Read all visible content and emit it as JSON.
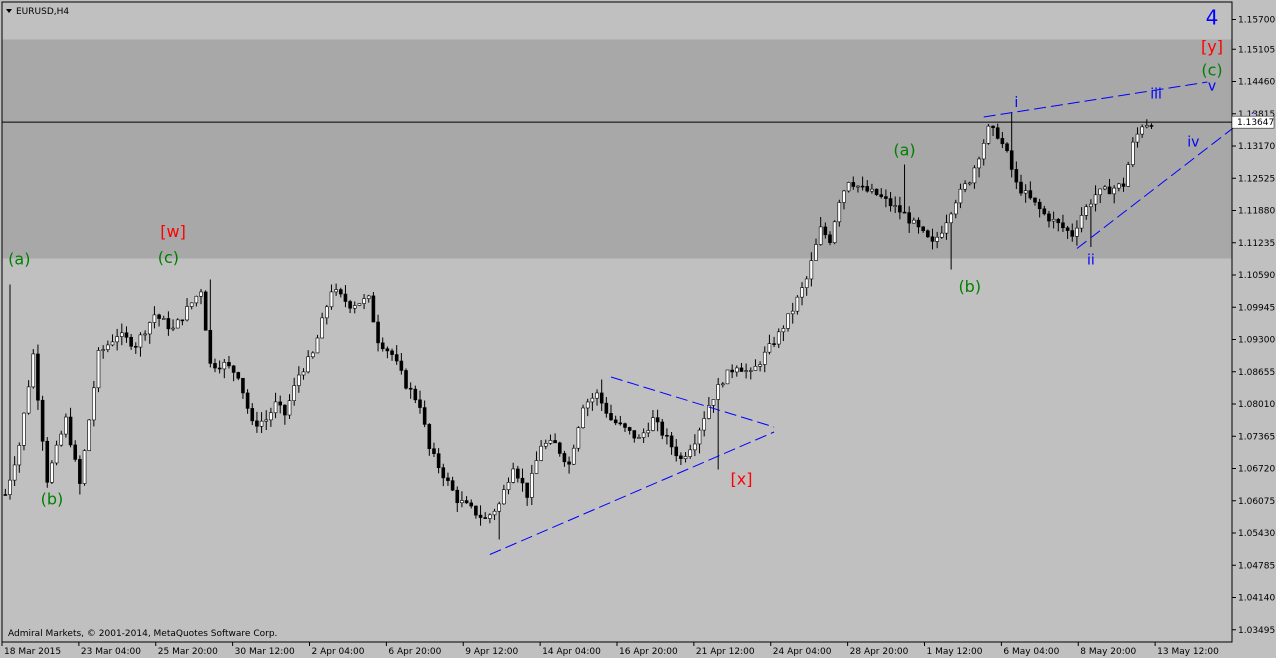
{
  "symbol_label": "EURUSD,H4",
  "copyright": "Admiral Markets, © 2001-2014, MetaQuotes Software Corp.",
  "current_price": "1.13647",
  "colors": {
    "background": "#c0c0c0",
    "zone": "#a8a8a8",
    "candle": "#000000",
    "wave_green": "#008000",
    "wave_red": "#ff0000",
    "wave_blue": "#0000ff"
  },
  "chart_data": {
    "type": "candlestick",
    "timeframe": "H4",
    "ylim": [
      1.0325,
      1.1605
    ],
    "y_ticks": [
      "1.15700",
      "1.15105",
      "1.14460",
      "1.13815",
      "1.13170",
      "1.12525",
      "1.11880",
      "1.11235",
      "1.10590",
      "1.09945",
      "1.09300",
      "1.08655",
      "1.08010",
      "1.07365",
      "1.06720",
      "1.06075",
      "1.05430",
      "1.04785",
      "1.04140",
      "1.03495"
    ],
    "x_ticks": [
      "18 Mar 2015",
      "23 Mar 04:00",
      "25 Mar 20:00",
      "30 Mar 12:00",
      "2 Apr 04:00",
      "6 Apr 20:00",
      "9 Apr 12:00",
      "14 Apr 04:00",
      "16 Apr 20:00",
      "21 Apr 12:00",
      "24 Apr 04:00",
      "28 Apr 20:00",
      "1 May 12:00",
      "6 May 04:00",
      "8 May 20:00",
      "13 May 12:00"
    ],
    "zone": {
      "from": 1.1092,
      "to": 1.153
    },
    "current_price": 1.13647,
    "close_path": [
      [
        0,
        1.062
      ],
      [
        3,
        1.072
      ],
      [
        6,
        1.09
      ],
      [
        9,
        1.065
      ],
      [
        13,
        1.077
      ],
      [
        16,
        1.064
      ],
      [
        20,
        1.09
      ],
      [
        24,
        1.094
      ],
      [
        28,
        1.092
      ],
      [
        32,
        1.098
      ],
      [
        36,
        1.095
      ],
      [
        39,
        1.099
      ],
      [
        42,
        1.103
      ],
      [
        44,
        1.088
      ],
      [
        47,
        1.088
      ],
      [
        50,
        1.086
      ],
      [
        53,
        1.076
      ],
      [
        56,
        1.077
      ],
      [
        58,
        1.08
      ],
      [
        60,
        1.078
      ],
      [
        63,
        1.086
      ],
      [
        66,
        1.09
      ],
      [
        70,
        1.103
      ],
      [
        74,
        1.1
      ],
      [
        78,
        1.101
      ],
      [
        80,
        1.093
      ],
      [
        83,
        1.09
      ],
      [
        86,
        1.084
      ],
      [
        89,
        1.08
      ],
      [
        91,
        1.071
      ],
      [
        94,
        1.066
      ],
      [
        97,
        1.061
      ],
      [
        100,
        1.059
      ],
      [
        103,
        1.057
      ],
      [
        106,
        1.06
      ],
      [
        109,
        1.068
      ],
      [
        112,
        1.062
      ],
      [
        115,
        1.072
      ],
      [
        118,
        1.072
      ],
      [
        121,
        1.068
      ],
      [
        124,
        1.08
      ],
      [
        127,
        1.082
      ],
      [
        130,
        1.077
      ],
      [
        133,
        1.075
      ],
      [
        136,
        1.073
      ],
      [
        139,
        1.077
      ],
      [
        142,
        1.073
      ],
      [
        145,
        1.069
      ],
      [
        148,
        1.073
      ],
      [
        151,
        1.08
      ],
      [
        154,
        1.085
      ],
      [
        157,
        1.088
      ],
      [
        160,
        1.086
      ],
      [
        163,
        1.09
      ],
      [
        166,
        1.094
      ],
      [
        169,
        1.099
      ],
      [
        172,
        1.105
      ],
      [
        175,
        1.115
      ],
      [
        177,
        1.113
      ],
      [
        179,
        1.121
      ],
      [
        181,
        1.125
      ],
      [
        184,
        1.123
      ],
      [
        187,
        1.122
      ],
      [
        190,
        1.12
      ],
      [
        193,
        1.118
      ],
      [
        196,
        1.115
      ],
      [
        199,
        1.112
      ],
      [
        201,
        1.115
      ],
      [
        204,
        1.121
      ],
      [
        207,
        1.125
      ],
      [
        209,
        1.13
      ],
      [
        211,
        1.135
      ],
      [
        213,
        1.134
      ],
      [
        215,
        1.13
      ],
      [
        217,
        1.124
      ],
      [
        220,
        1.121
      ],
      [
        223,
        1.118
      ],
      [
        226,
        1.116
      ],
      [
        229,
        1.114
      ],
      [
        231,
        1.118
      ],
      [
        234,
        1.122
      ],
      [
        237,
        1.123
      ],
      [
        240,
        1.124
      ],
      [
        242,
        1.132
      ],
      [
        244,
        1.136
      ],
      [
        246,
        1.1365
      ]
    ],
    "extremes": [
      {
        "i": 1,
        "v": 1.104
      },
      {
        "i": 16,
        "v": 1.062
      },
      {
        "i": 44,
        "v": 1.105
      },
      {
        "i": 106,
        "v": 1.053
      },
      {
        "i": 128,
        "v": 1.085
      },
      {
        "i": 153,
        "v": 1.067
      },
      {
        "i": 193,
        "v": 1.128
      },
      {
        "i": 203,
        "v": 1.107
      },
      {
        "i": 216,
        "v": 1.1385
      },
      {
        "i": 233,
        "v": 1.1115
      }
    ],
    "trendlines": [
      {
        "name": "triangle-upper",
        "from": [
          130,
          1.0855
        ],
        "to": [
          165,
          1.0755
        ],
        "style": "dashed"
      },
      {
        "name": "triangle-lower",
        "from": [
          104,
          1.05
        ],
        "to": [
          165,
          1.0745
        ],
        "style": "dashed"
      },
      {
        "name": "diagonal-upper",
        "from": [
          210,
          1.1375
        ],
        "to": [
          258,
          1.1445
        ],
        "style": "dashed"
      },
      {
        "name": "diagonal-lower",
        "from": [
          230,
          1.1112
        ],
        "to": [
          268,
          1.1385
        ],
        "style": "dashed"
      }
    ],
    "annotations": [
      {
        "text": "(a)",
        "i": 3,
        "price": 1.108,
        "color": "green",
        "size": 16
      },
      {
        "text": "(b)",
        "i": 10,
        "price": 1.06,
        "color": "green",
        "size": 16
      },
      {
        "text": "[w]",
        "i": 36,
        "price": 1.1135,
        "color": "red",
        "size": 16
      },
      {
        "text": "(c)",
        "i": 35,
        "price": 1.1083,
        "color": "green",
        "size": 16
      },
      {
        "text": "[x]",
        "i": 158,
        "price": 1.064,
        "color": "red",
        "size": 16
      },
      {
        "text": "(a)",
        "i": 193,
        "price": 1.1298,
        "color": "green",
        "size": 16
      },
      {
        "text": "(b)",
        "i": 207,
        "price": 1.1025,
        "color": "green",
        "size": 16
      },
      {
        "text": "i",
        "i": 217,
        "price": 1.1395,
        "color": "blue",
        "size": 14
      },
      {
        "text": "ii",
        "i": 233,
        "price": 1.108,
        "color": "blue",
        "size": 14
      },
      {
        "text": "iii",
        "i": 247,
        "price": 1.1412,
        "color": "blue",
        "size": 14
      },
      {
        "text": "iv",
        "i": 255,
        "price": 1.1316,
        "color": "blue",
        "size": 14
      },
      {
        "text": "v",
        "i": 259,
        "price": 1.1428,
        "color": "blue",
        "size": 14
      },
      {
        "text": "(c)",
        "i": 259,
        "price": 1.1458,
        "color": "green",
        "size": 16
      },
      {
        "text": "[y]",
        "i": 259,
        "price": 1.1505,
        "color": "red",
        "size": 16
      },
      {
        "text": "4",
        "i": 259,
        "price": 1.156,
        "color": "blue",
        "size": 20
      }
    ]
  }
}
